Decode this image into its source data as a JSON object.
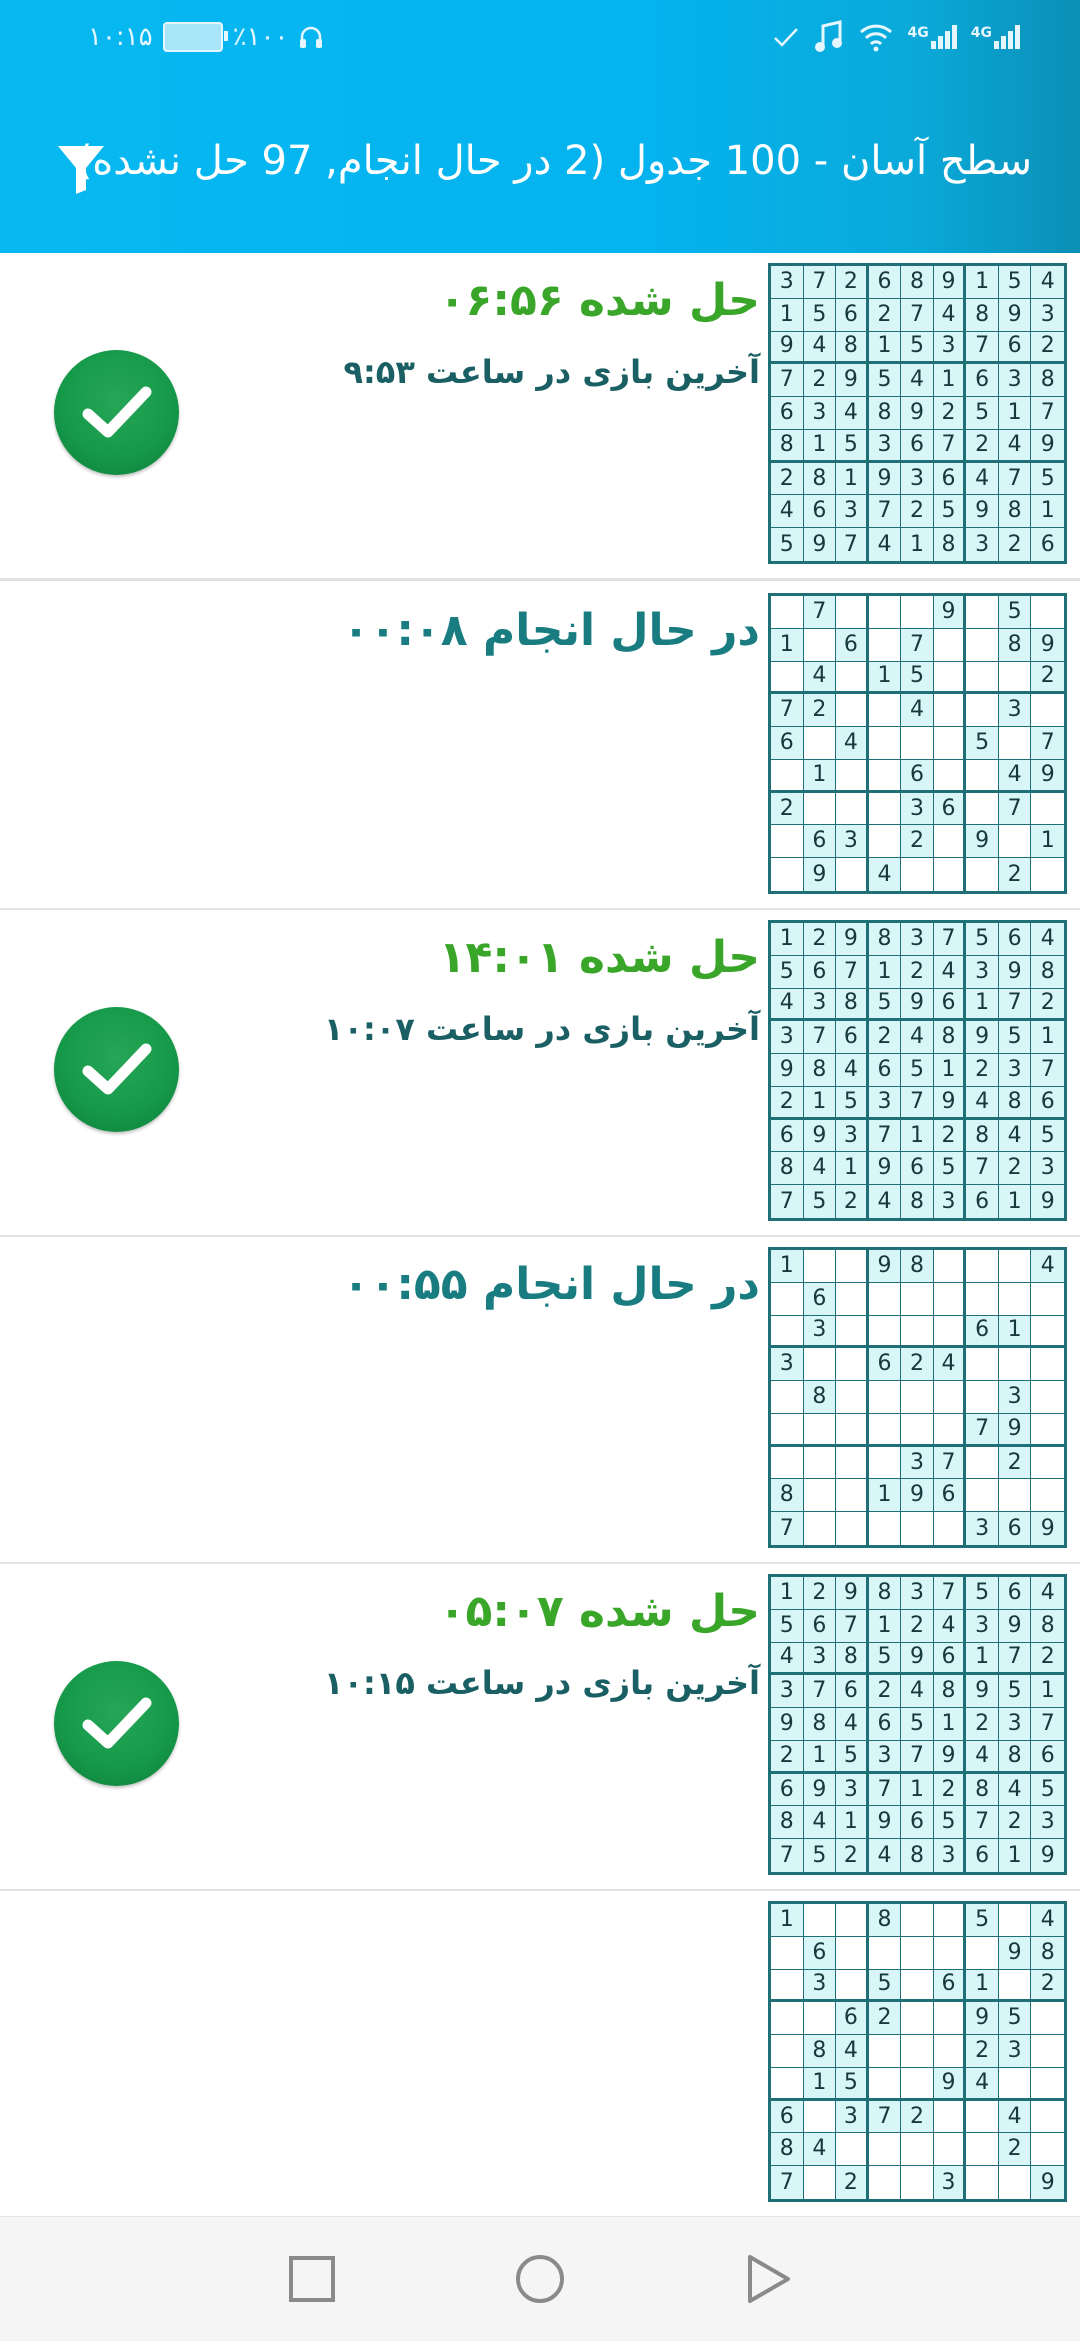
{
  "status_bar": {
    "time": "۱۰:۱۵",
    "battery": "٪۱۰۰",
    "net1": "4G",
    "net2": "4G"
  },
  "header": {
    "title": "سطح آسان - 100 جدول (2 در حال انجام, 97 حل نشده)",
    "filter_icon": "filter-icon",
    "background_color": "#07b8f1"
  },
  "colors": {
    "solved": "#3aa629",
    "in_progress": "#197c80",
    "cell_fill": "#d8f6f8",
    "grid": "#1f6f76"
  },
  "items": [
    {
      "status": "حل شده  ۰۶:۵۶",
      "subtitle": "آخرین بازی در ساعت ۹:۵۳",
      "solved": true,
      "grid": [
        "372689154",
        "156274893",
        "948153762",
        "729541638",
        "634892517",
        "815367249",
        "281936475",
        "463725981",
        "597418326"
      ]
    },
    {
      "status": "در حال انجام  ۰۰:۰۸",
      "subtitle": "",
      "solved": false,
      "grid": [
        "07000905",
        "10607 089",
        "040150002",
        "720040030",
        "604000507",
        "010060049",
        "200036070",
        "063020901",
        "090400020"
      ]
    },
    {
      "status": "حل شده  ۱۴:۰۱",
      "subtitle": "آخرین بازی در ساعت ۱۰:۰۷",
      "solved": true,
      "grid": [
        "129837564",
        "567124398",
        "438596172",
        "376248951",
        "984651237",
        "215379486",
        "693712845",
        "841965723",
        "752483619"
      ]
    },
    {
      "status": "در حال انجام  ۰۰:۵۵",
      "subtitle": "",
      "solved": false,
      "grid": [
        "100980004",
        "060000000",
        "030000610",
        "300624000",
        "080000030",
        "000000790",
        "000037020",
        "800196000",
        "700000369"
      ]
    },
    {
      "status": "حل شده  ۰۵:۰۷",
      "subtitle": "آخرین بازی در ساعت ۱۰:۱۵",
      "solved": true,
      "grid": [
        "129837564",
        "567124398",
        "438596172",
        "376248951",
        "984651237",
        "215379486",
        "693712845",
        "841965723",
        "752483619"
      ]
    },
    {
      "status": "",
      "subtitle": "",
      "solved": false,
      "grid": [
        "100800504",
        "060000098",
        "030506102",
        "006200950",
        "084000230",
        "015009400",
        "603720040",
        "840000020",
        "702003009"
      ]
    }
  ],
  "nav": {
    "recent": "square",
    "home": "circle",
    "back": "triangle"
  }
}
